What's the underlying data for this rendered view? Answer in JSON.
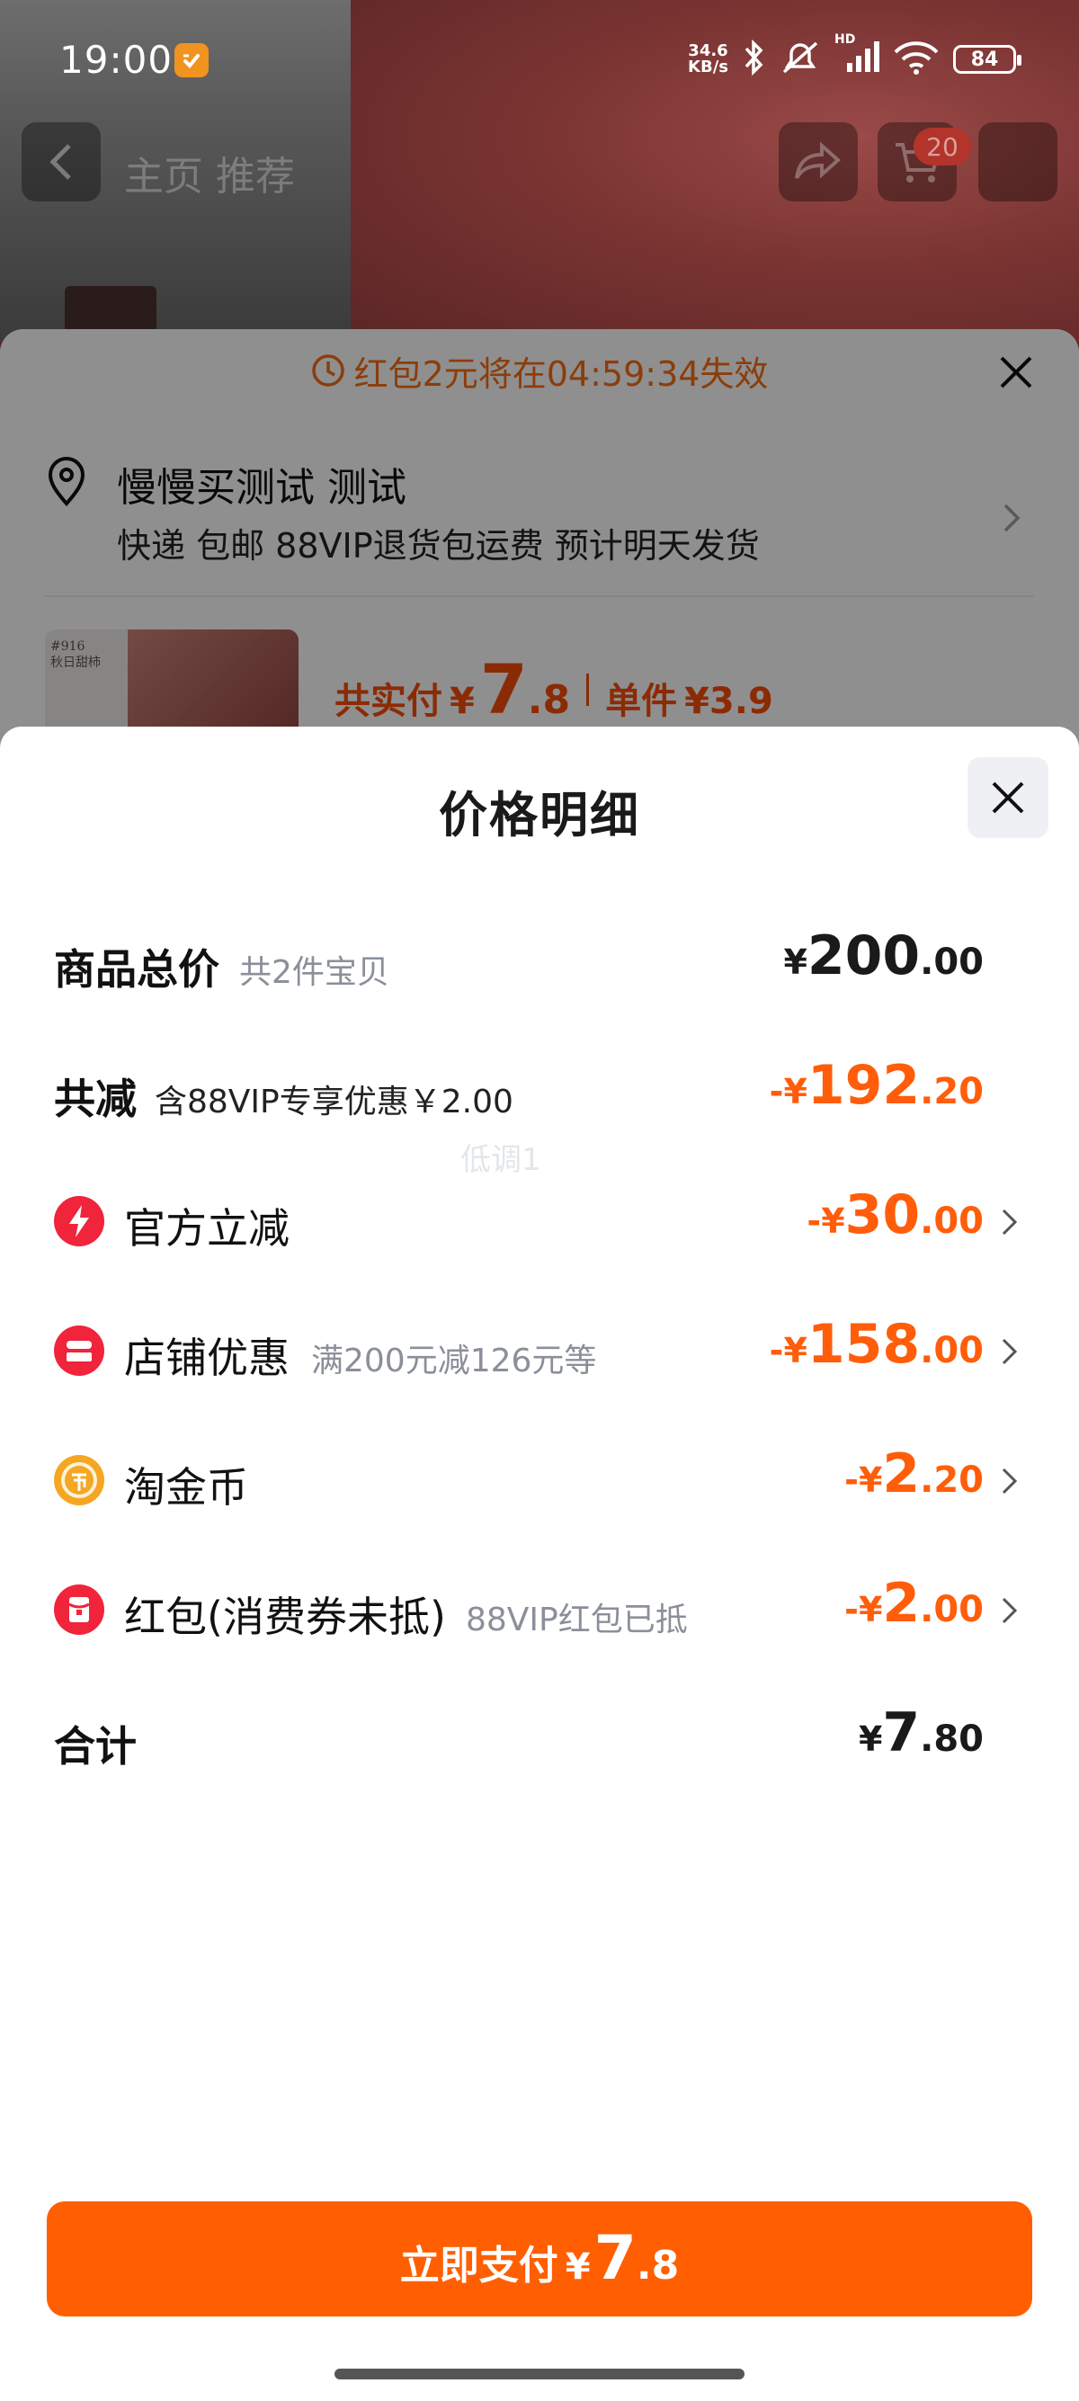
{
  "status_bar": {
    "time": "19:00",
    "net_speed_value": "34.6",
    "net_speed_unit": "KB/s",
    "hd_label": "HD",
    "battery": "84",
    "icons": [
      "bluetooth-icon",
      "mute-icon",
      "signal-icon",
      "wifi-icon",
      "battery-icon"
    ]
  },
  "product_nav": {
    "shop_title": "主页 推荐",
    "cart_badge": "20"
  },
  "order_sheet": {
    "countdown_text": "红包2元将在04:59:34失效",
    "address_name": "慢慢买测试 测试",
    "address_detail": "快递 包邮 88VIP退货包运费 预计明天发货",
    "item_label_line1": "#916",
    "item_label_line2": "秋日甜柿",
    "total_label": "共实付",
    "total_currency": "¥",
    "total_int": "7",
    "total_dec": ".8",
    "unit_label": "单件",
    "unit_price": "¥3.9"
  },
  "price_sheet": {
    "title": "价格明细",
    "watermark": "低调1",
    "rows": [
      {
        "label": "商品总价",
        "sub": "共2件宝贝",
        "sign": "",
        "currency": "¥",
        "int": "200",
        "dec": ".00"
      },
      {
        "label": "共减",
        "sub": "含88VIP专享优惠￥2.00",
        "sign": "-",
        "currency": "¥",
        "int": "192",
        "dec": ".20"
      },
      {
        "label": "官方立减",
        "sub": "",
        "sign": "-",
        "currency": "¥",
        "int": "30",
        "dec": ".00",
        "icon": "lightning-icon"
      },
      {
        "label": "店铺优惠",
        "sub": "满200元减126元等",
        "sign": "-",
        "currency": "¥",
        "int": "158",
        "dec": ".00",
        "icon": "store-coupon-icon"
      },
      {
        "label": "淘金币",
        "sub": "",
        "sign": "-",
        "currency": "¥",
        "int": "2",
        "dec": ".20",
        "icon": "coin-icon"
      },
      {
        "label": "红包(消费券未抵)",
        "sub": "88VIP红包已抵",
        "sign": "-",
        "currency": "¥",
        "int": "2",
        "dec": ".00",
        "icon": "red-packet-icon"
      },
      {
        "label": "合计",
        "sub": "",
        "sign": "",
        "currency": "¥",
        "int": "7",
        "dec": ".80"
      }
    ],
    "pay_button": {
      "label": "立即支付",
      "currency": "¥",
      "int": "7",
      "dec": ".8"
    }
  },
  "colors": {
    "accent_orange": "#ff5f00",
    "discount_orange": "#ff5d0a",
    "coin_gold": "#f5a623",
    "red_icon": "#f0243a"
  }
}
